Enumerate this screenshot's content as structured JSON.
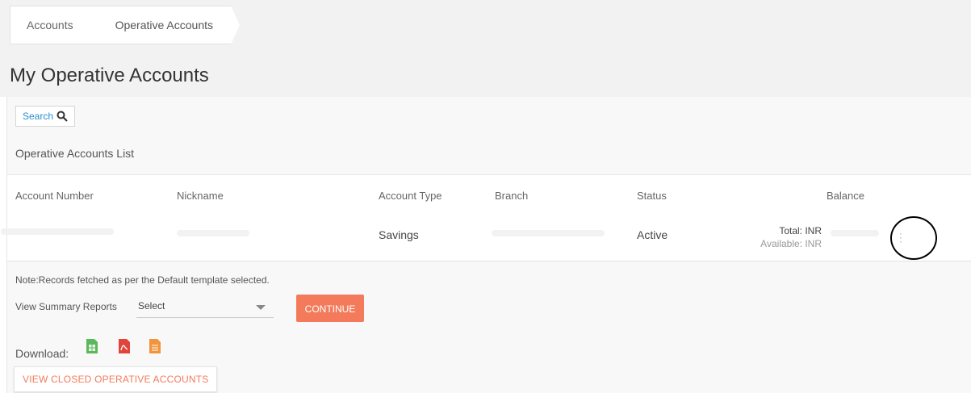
{
  "breadcrumb": {
    "items": [
      "Accounts",
      "Operative Accounts"
    ]
  },
  "page": {
    "title": "My Operative Accounts"
  },
  "search": {
    "label": "Search"
  },
  "list": {
    "title": "Operative Accounts List"
  },
  "table": {
    "headers": [
      "Account Number",
      "Nickname",
      "Account Type",
      "Branch",
      "Status",
      "Balance"
    ],
    "rows": [
      {
        "account_number": "",
        "nickname": "",
        "account_type": "Savings",
        "branch": "",
        "status": "Active",
        "balance_total": "Total: INR",
        "balance_available": "Available: INR",
        "actions_icon": "kebab-menu-icon"
      }
    ]
  },
  "note": "Note:Records fetched as per the Default template selected.",
  "summary": {
    "label": "View Summary Reports",
    "selected": "Select"
  },
  "buttons": {
    "continue": "CONTINUE",
    "closed_accounts": "VIEW CLOSED OPERATIVE ACCOUNTS"
  },
  "download": {
    "label": "Download:",
    "icons": [
      {
        "name": "excel-icon",
        "color": "#5cb85c"
      },
      {
        "name": "pdf-icon",
        "color": "#e0453c"
      },
      {
        "name": "csv-icon",
        "color": "#f0953e"
      }
    ]
  },
  "colors": {
    "accent": "#f37b5b",
    "link": "#2a8fd0"
  }
}
